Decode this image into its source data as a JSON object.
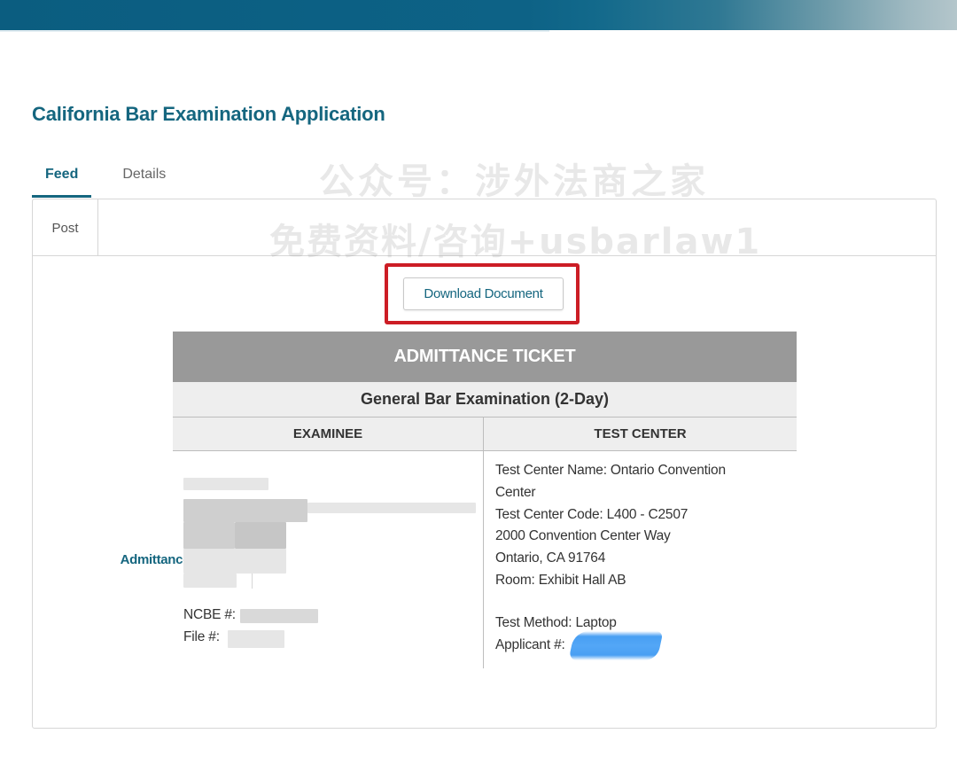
{
  "page": {
    "title": "California Bar Examination Application"
  },
  "tabs": [
    {
      "label": "Feed",
      "active": true
    },
    {
      "label": "Details",
      "active": false
    }
  ],
  "sub_tabs": [
    {
      "label": "Post",
      "active": false
    },
    {
      "label": "Admittance Ticket",
      "active": true
    }
  ],
  "watermark": {
    "line1": "公众号：涉外法商之家",
    "line2": "免费资料/咨询+usbarlaw1"
  },
  "download": {
    "label": "Download Document"
  },
  "ticket": {
    "header": "ADMITTANCE TICKET",
    "exam": "General Bar Examination (2-Day)",
    "col_examinee": "EXAMINEE",
    "col_test_center": "TEST CENTER",
    "examinee": {
      "ncbe_label": "NCBE #:",
      "file_label": "File #:"
    },
    "test_center": {
      "name_line1": "Test Center Name: Ontario Convention",
      "name_line2": "Center",
      "code": "Test Center Code: L400 - C2507",
      "street": "2000 Convention Center Way",
      "city": "Ontario,  CA  91764",
      "room": "Room: Exhibit Hall AB",
      "method": "Test Method: Laptop",
      "applicant_label": "Applicant #:"
    }
  },
  "colors": {
    "brand": "#15667f",
    "banner": "#0b5d80",
    "ticket_header": "#999999",
    "highlight": "#cc1d25",
    "redaction_scribble": "#3f9af2"
  }
}
